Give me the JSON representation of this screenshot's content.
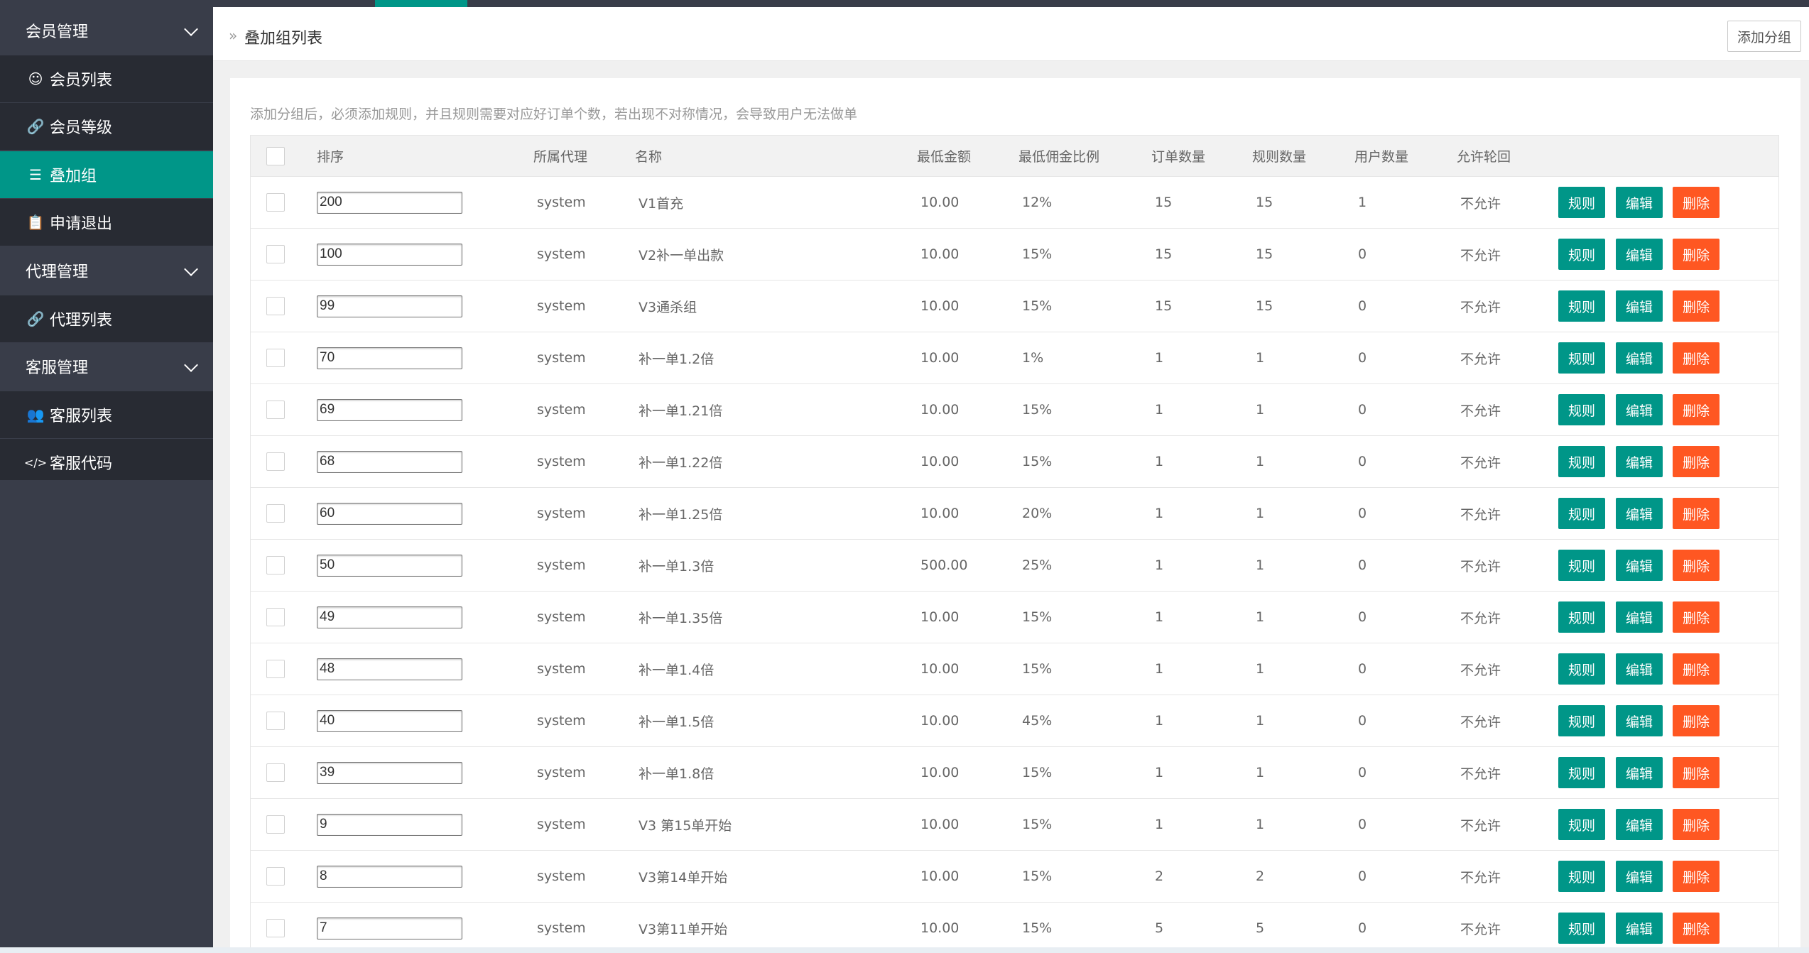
{
  "sidebar": {
    "items": [
      {
        "label": "会员管理",
        "type": "group",
        "icon": ""
      },
      {
        "label": "会员列表",
        "type": "child",
        "icon": "user-icon"
      },
      {
        "label": "会员等级",
        "type": "child",
        "icon": "link-icon"
      },
      {
        "label": "叠加组",
        "type": "child",
        "icon": "list-icon",
        "active": true
      },
      {
        "label": "申请退出",
        "type": "child",
        "icon": "clipboard-icon"
      },
      {
        "label": "代理管理",
        "type": "group",
        "icon": ""
      },
      {
        "label": "代理列表",
        "type": "child",
        "icon": "link-icon"
      },
      {
        "label": "客服管理",
        "type": "group",
        "icon": ""
      },
      {
        "label": "客服列表",
        "type": "child",
        "icon": "users-icon"
      },
      {
        "label": "客服代码",
        "type": "child",
        "icon": "code-icon"
      }
    ]
  },
  "header": {
    "title": "叠加组列表",
    "add_button": "添加分组"
  },
  "notice": "添加分组后，必须添加规则，并且规则需要对应好订单个数，若出现不对称情况，会导致用户无法做单",
  "table": {
    "columns": [
      "排序",
      "所属代理",
      "名称",
      "最低金额",
      "最低佣金比例",
      "订单数量",
      "规则数量",
      "用户数量",
      "允许轮回"
    ],
    "action_labels": {
      "rule": "规则",
      "edit": "编辑",
      "delete": "删除"
    },
    "rows": [
      {
        "sort": "200",
        "agent": "system",
        "name": "V1首充",
        "min_amount": "10.00",
        "commission": "12%",
        "orders": "15",
        "rules": "15",
        "users": "1",
        "loop": "不允许"
      },
      {
        "sort": "100",
        "agent": "system",
        "name": "V2补一单出款",
        "min_amount": "10.00",
        "commission": "15%",
        "orders": "15",
        "rules": "15",
        "users": "0",
        "loop": "不允许"
      },
      {
        "sort": "99",
        "agent": "system",
        "name": "V3通杀组",
        "min_amount": "10.00",
        "commission": "15%",
        "orders": "15",
        "rules": "15",
        "users": "0",
        "loop": "不允许"
      },
      {
        "sort": "70",
        "agent": "system",
        "name": "补一单1.2倍",
        "min_amount": "10.00",
        "commission": "1%",
        "orders": "1",
        "rules": "1",
        "users": "0",
        "loop": "不允许"
      },
      {
        "sort": "69",
        "agent": "system",
        "name": "补一单1.21倍",
        "min_amount": "10.00",
        "commission": "15%",
        "orders": "1",
        "rules": "1",
        "users": "0",
        "loop": "不允许"
      },
      {
        "sort": "68",
        "agent": "system",
        "name": "补一单1.22倍",
        "min_amount": "10.00",
        "commission": "15%",
        "orders": "1",
        "rules": "1",
        "users": "0",
        "loop": "不允许"
      },
      {
        "sort": "60",
        "agent": "system",
        "name": "补一单1.25倍",
        "min_amount": "10.00",
        "commission": "20%",
        "orders": "1",
        "rules": "1",
        "users": "0",
        "loop": "不允许"
      },
      {
        "sort": "50",
        "agent": "system",
        "name": "补一单1.3倍",
        "min_amount": "500.00",
        "commission": "25%",
        "orders": "1",
        "rules": "1",
        "users": "0",
        "loop": "不允许"
      },
      {
        "sort": "49",
        "agent": "system",
        "name": "补一单1.35倍",
        "min_amount": "10.00",
        "commission": "15%",
        "orders": "1",
        "rules": "1",
        "users": "0",
        "loop": "不允许"
      },
      {
        "sort": "48",
        "agent": "system",
        "name": "补一单1.4倍",
        "min_amount": "10.00",
        "commission": "15%",
        "orders": "1",
        "rules": "1",
        "users": "0",
        "loop": "不允许"
      },
      {
        "sort": "40",
        "agent": "system",
        "name": "补一单1.5倍",
        "min_amount": "10.00",
        "commission": "45%",
        "orders": "1",
        "rules": "1",
        "users": "0",
        "loop": "不允许"
      },
      {
        "sort": "39",
        "agent": "system",
        "name": "补一单1.8倍",
        "min_amount": "10.00",
        "commission": "15%",
        "orders": "1",
        "rules": "1",
        "users": "0",
        "loop": "不允许"
      },
      {
        "sort": "9",
        "agent": "system",
        "name": "V3 第15单开始",
        "min_amount": "10.00",
        "commission": "15%",
        "orders": "1",
        "rules": "1",
        "users": "0",
        "loop": "不允许"
      },
      {
        "sort": "8",
        "agent": "system",
        "name": "V3第14单开始",
        "min_amount": "10.00",
        "commission": "15%",
        "orders": "2",
        "rules": "2",
        "users": "0",
        "loop": "不允许"
      },
      {
        "sort": "7",
        "agent": "system",
        "name": "V3第11单开始",
        "min_amount": "10.00",
        "commission": "15%",
        "orders": "5",
        "rules": "5",
        "users": "0",
        "loop": "不允许"
      }
    ]
  },
  "colors": {
    "accent": "#009688",
    "danger": "#ff5722",
    "sidebar": "#393d49",
    "sidebar_child": "#282b33"
  }
}
